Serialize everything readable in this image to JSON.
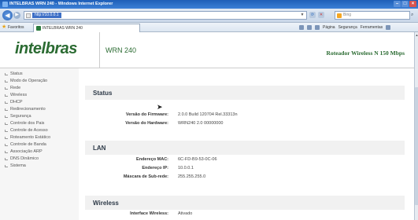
{
  "window": {
    "title": "INTELBRAS WRN 240 - Windows Internet Explorer"
  },
  "browser": {
    "address": "http://10.0.0.1",
    "search_placeholder": "Bing",
    "favorites_label": "Favoritos",
    "tab_title": "INTELBRAS WRN 240",
    "commands": [
      "Página",
      "Segurança",
      "Ferramentas"
    ]
  },
  "header": {
    "logo": "intelbras",
    "model": "WRN 240",
    "product": "Roteador Wireless N 150 Mbps"
  },
  "sidebar": {
    "items": [
      "Status",
      "Modo de Operação",
      "Rede",
      "Wireless",
      "DHCP",
      "Redirecionamento",
      "Segurança",
      "Controle dos Pais",
      "Controle de Acesso",
      "Roteamento Estático",
      "Controle de Banda",
      "Associação ARP",
      "DNS Dinâmico",
      "Sistema"
    ]
  },
  "status": {
    "title": "Status",
    "rows": [
      {
        "label": "Versão do Firmware:",
        "value": "2.0.0 Build 120704 Rel.33313n"
      },
      {
        "label": "Versão do Hardware:",
        "value": "WRN240 2.0 00000000"
      }
    ]
  },
  "lan": {
    "title": "LAN",
    "rows": [
      {
        "label": "Endereço MAC:",
        "value": "6C-FD-B9-53-0C-06"
      },
      {
        "label": "Endereço IP:",
        "value": "10.0.0.1"
      },
      {
        "label": "Máscara de Sub-rede:",
        "value": "255.255.255.0"
      }
    ]
  },
  "wireless": {
    "title": "Wireless",
    "rows": [
      {
        "label": "Interface Wireless:",
        "value": "Ativado"
      }
    ]
  },
  "colors": {
    "brand": "#2b6b32",
    "titlebar": "#1e5fb8"
  }
}
